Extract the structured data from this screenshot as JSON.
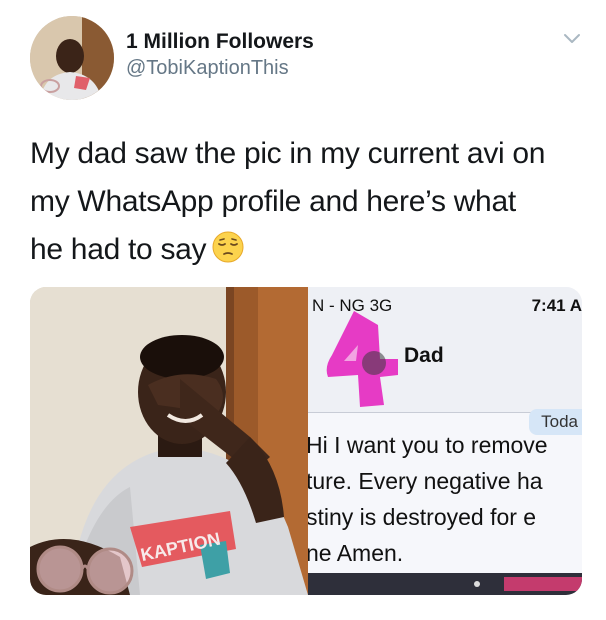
{
  "author": {
    "display_name": "1 Million Followers",
    "handle": "@TobiKaptionThis"
  },
  "tweet": {
    "text_lines": [
      "My dad saw the pic in my current avi on",
      "my WhatsApp profile and here’s what",
      "he had to say"
    ],
    "emoji": "pensive-face"
  },
  "media": {
    "left_photo": {
      "shirt_logo_text": "KAPTION"
    },
    "screenshot": {
      "status_left": "N - NG  3G",
      "status_time": "7:41 A",
      "contact_name": "Dad",
      "date_label": "Toda",
      "message_lines": [
        "Hi I want you to remove",
        "ture. Every negative ha",
        "stiny is destroyed for e",
        "ne Amen."
      ]
    }
  },
  "colors": {
    "text": "#14171a",
    "handle": "#657786",
    "scribble_pink": "#e63bc5",
    "date_pill": "#d6e6f7"
  }
}
